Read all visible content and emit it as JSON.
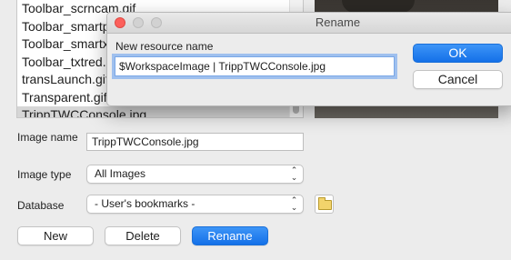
{
  "file_list": {
    "items": [
      "Toolbar_scrncam.gif",
      "Toolbar_smartp",
      "Toolbar_smartxt",
      "Toolbar_txtred.g",
      "transLaunch.gif",
      "Transparent.gif",
      "TrippTWCConsole.jpg"
    ],
    "selected_index": 6
  },
  "form": {
    "image_name_label": "Image name",
    "image_name_value": "TrippTWCConsole.jpg",
    "image_type_label": "Image type",
    "image_type_value": "All Images",
    "database_label": "Database",
    "database_value": "- User's bookmarks -"
  },
  "buttons": {
    "new": "New",
    "delete": "Delete",
    "rename": "Rename"
  },
  "dialog": {
    "title": "Rename",
    "field_label": "New resource name",
    "field_value": "$WorkspaceImage | TrippTWCConsole.jpg",
    "ok": "OK",
    "cancel": "Cancel"
  },
  "icons": {
    "popup_arrows": "⌃⌄",
    "folder": "folder-icon"
  },
  "colors": {
    "accent": "#1470e8",
    "close_light": "#fc605b"
  }
}
